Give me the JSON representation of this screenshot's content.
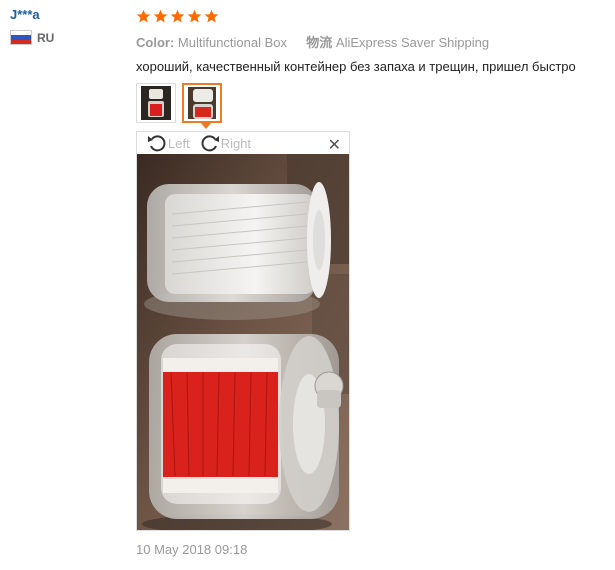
{
  "reviewer": {
    "name": "J***a",
    "country": "RU"
  },
  "review": {
    "rating": 5,
    "color_label": "Color:",
    "color_value": "Multifunctional Box",
    "shipping_label": "物流",
    "shipping_value": "AliExpress Saver Shipping",
    "text": "хороший, качественный контейнер без запаха и трещин, пришел быстро",
    "date": "10 May 2018 09:18"
  },
  "viewer": {
    "left_label": "Left",
    "right_label": "Right",
    "close_icon": "close-icon"
  },
  "colors": {
    "accent": "#f07a22",
    "star": "#ff6a00",
    "username": "#1a5fa8"
  }
}
